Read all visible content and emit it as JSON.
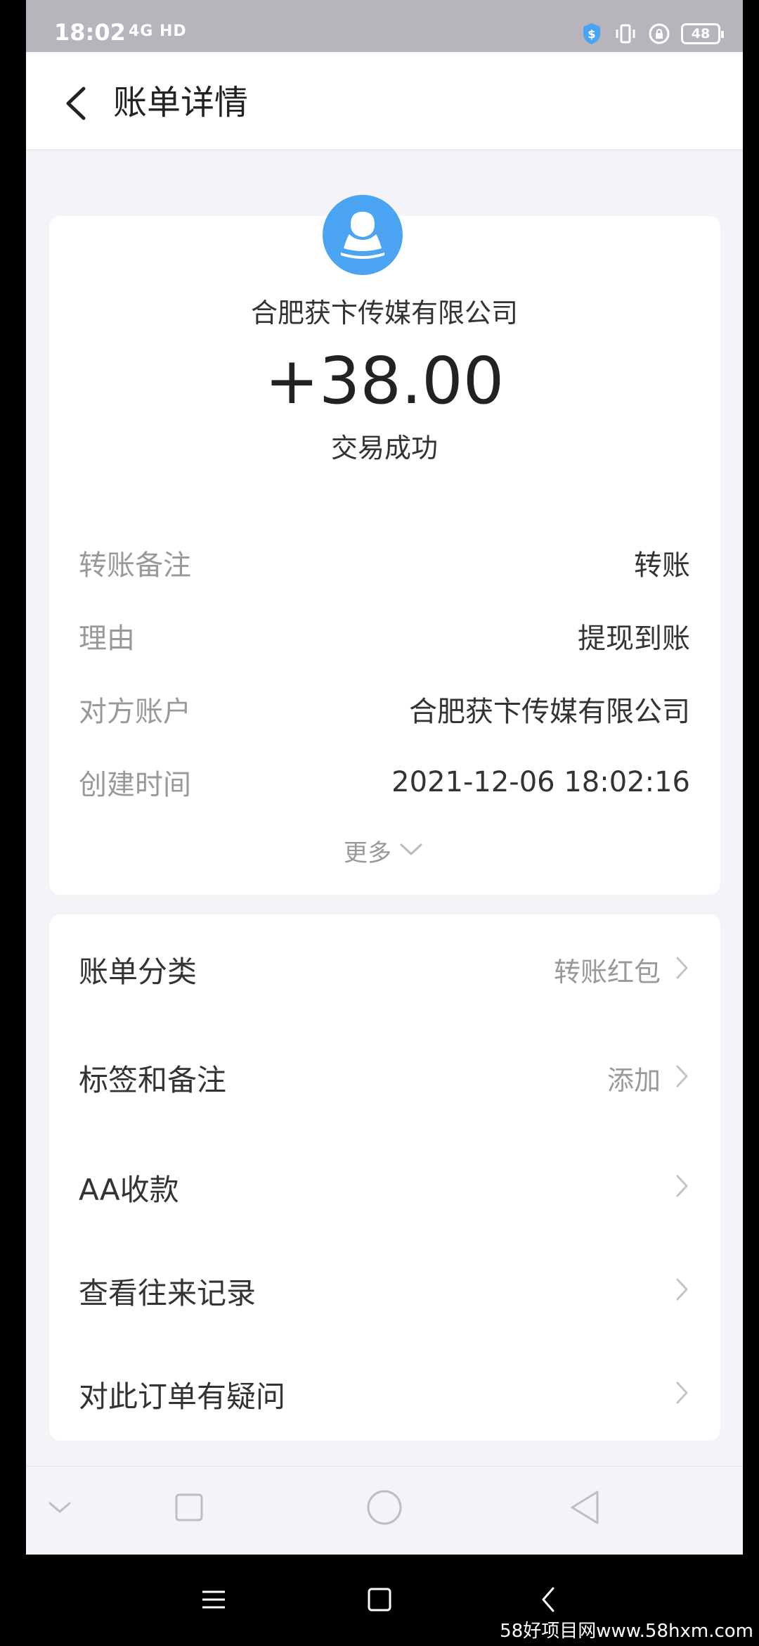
{
  "status_bar": {
    "time": "18:02",
    "network": "4G HD",
    "battery": "48",
    "icons": [
      "shield-dollar-icon",
      "vibrate-icon",
      "lock-rotation-icon"
    ]
  },
  "header": {
    "title": "账单详情",
    "back_icon": "chevron-left-icon"
  },
  "summary": {
    "avatar_icon": "user-avatar-icon",
    "avatar_color": "#4aa4f2",
    "merchant": "合肥获卞传媒有限公司",
    "amount": "+38.00",
    "status": "交易成功"
  },
  "details": [
    {
      "label": "转账备注",
      "value": "转账"
    },
    {
      "label": "理由",
      "value": "提现到账"
    },
    {
      "label": "对方账户",
      "value": "合肥获卞传媒有限公司"
    },
    {
      "label": "创建时间",
      "value": "2021-12-06 18:02:16"
    }
  ],
  "more_label": "更多",
  "actions": [
    {
      "label": "账单分类",
      "value": "转账红包"
    },
    {
      "label": "标签和备注",
      "value": "添加"
    },
    {
      "label": "AA收款",
      "value": ""
    },
    {
      "label": "查看往来记录",
      "value": ""
    },
    {
      "label": "对此订单有疑问",
      "value": ""
    }
  ],
  "watermark": "58好项目网www.58hxm.com"
}
